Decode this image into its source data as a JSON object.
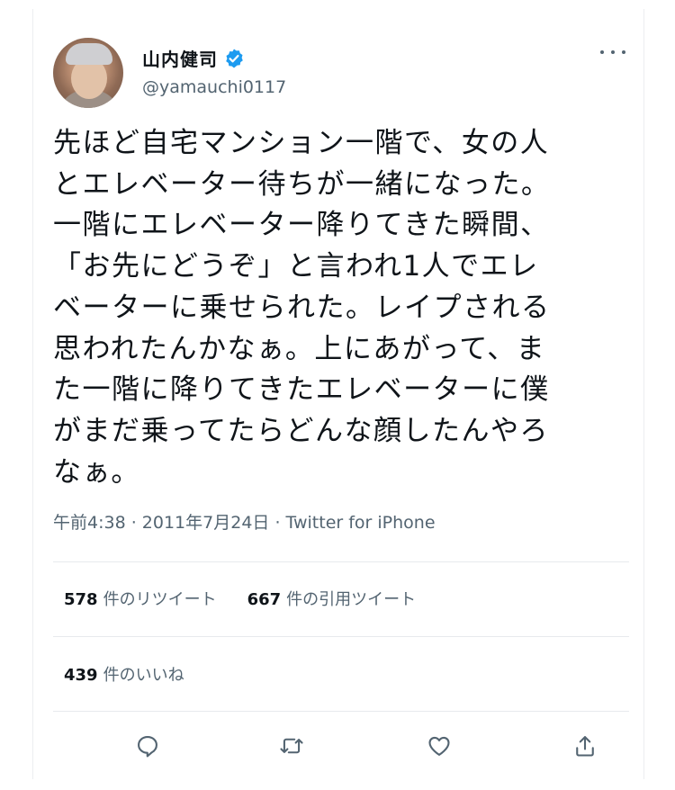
{
  "tweet": {
    "author_name": "山内健司",
    "handle": "@yamauchi0117",
    "text": "先ほど自宅マンション一階で、女の人\nとエレベーター待ちが一緒になった。\n一階にエレベーター降りてきた瞬間、\n「お先にどうぞ」と言われ1人でエレ\nベーターに乗せられた。レイプされる\n思われたんかなぁ。上にあがって、ま\nた一階に降りてきたエレベーターに僕\nがまだ乗ってたらどんな顔したんやろ\nなぁ。",
    "meta": "午前4:38 · 2011年7月24日 · Twitter for iPhone"
  },
  "stats": {
    "retweets_count": "578",
    "retweets_label": "件のリツイート",
    "quotes_count": "667",
    "quotes_label": "件の引用ツイート",
    "likes_count": "439",
    "likes_label": "件のいいね"
  },
  "actions": [
    "reply-icon",
    "retweet-icon",
    "like-icon",
    "share-icon"
  ],
  "colors": {
    "verified": "#1d9bf0",
    "text": "#0f1419",
    "secondary": "#536471",
    "divider": "#e7eaed"
  }
}
